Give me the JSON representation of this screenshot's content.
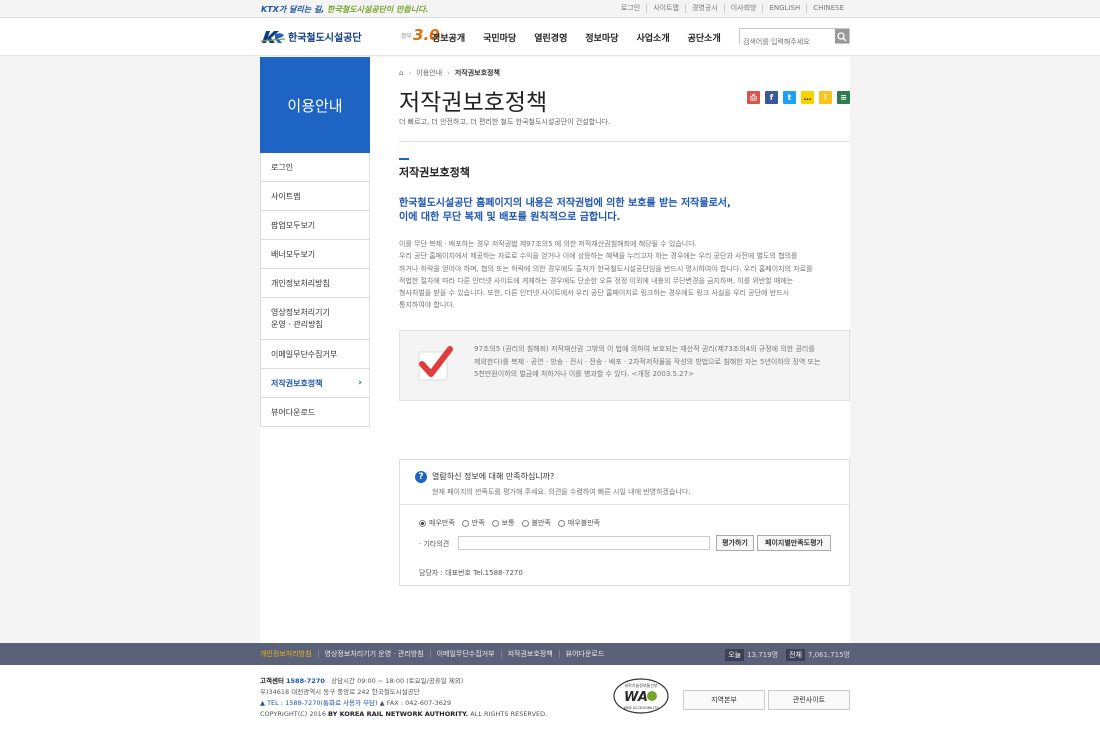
{
  "header": {
    "slogan_prefix": "KTX가 달리는 길, ",
    "slogan_highlight": "한국철도시설공단이 만듭니다.",
    "top_links": [
      "로그인",
      "사이트맵",
      "경영공시",
      "이사회방",
      "ENGLISH",
      "CHINESE"
    ],
    "logo_text": "한국철도시설공단",
    "gov30_small": "정부",
    "gov30_big": "3.0",
    "menu": [
      "정보공개",
      "국민마당",
      "열린경영",
      "정보마당",
      "사업소개",
      "공단소개"
    ],
    "search_placeholder": "검색어를 입력해주세요"
  },
  "sidebar": {
    "title": "이용안내",
    "items": [
      {
        "label": "로그인"
      },
      {
        "label": "사이트맵"
      },
      {
        "label": "팝업모두보기"
      },
      {
        "label": "배너모두보기"
      },
      {
        "label": "개인정보처리방침"
      },
      {
        "label": "영상정보처리기기\n운영 · 관리방침"
      },
      {
        "label": "이메일무단수집거부"
      },
      {
        "label": "저작권보호정책",
        "active": true
      },
      {
        "label": "뷰어다운로드"
      }
    ],
    "active_arrow": "›"
  },
  "breadcrumb": {
    "home": "⌂",
    "sep1": "›",
    "level1": "이용안내",
    "sep2": "›",
    "current": "저작권보호정책"
  },
  "page": {
    "title": "저작권보호정책",
    "description": "더 빠르고, 더 안전하고, 더 편리한 철도 한국철도시설공단이 건설합니다.",
    "section_title": "저작권보호정책",
    "lead_line1": "한국철도시설공단 홈페이지의 내용은 저작권법에 의한 보호를 받는 저작물로서,",
    "lead_line2": "이에 대한 무단 복제 및 배포를 원칙적으로 금합니다.",
    "body": [
      "이를 무단 복제 · 배포하는 경우 저작권법 제97조의5 에 의한 저작재산권침해죄에 해당될 수 있습니다.",
      "우리 공단 홈페이지에서 제공하는 자료로 수익을 얻거나 이에 상응하는 혜택을 누리고자 하는 경우에는 우리 공단과 사전에 별도의 협의를",
      "하거나 허락을 얻어야 하며, 협의 또는 허락에 의한 경우에도 출처가 한국철도시설공단임을 반드시 명시하여야 합니다. 우리 홈페이지의 자료를",
      "적법한 절차에 따라 다른 인터넷 사이트에 게재하는 경우에도 단순한 오류 정정 이외에 내용의 무단변경을 금지하며, 이를 위반할 때에는",
      "형사처벌을 받을 수 있습니다. 또한, 다른 인터넷 사이트에서 우리 공단 홈페이지로 링크하는 경우에도 링크 사실을 우리 공단에 반드시",
      "통지하여야 합니다."
    ],
    "notice": [
      "97조의5 (권리의 침해죄) 저작재산권 그밖의 이 법에 의하여 보호되는 재산적 권리(제73조의4의 규정에 의한 권리를",
      "제외한다)를 복제 · 공연 · 방송 · 전시 · 전송 · 배포 · 2차적저작물을 작성의 방법으로 침해한 자는 5년이하의 징역 또는",
      "5천만원이하의 벌금에 처하거나 이를 병과할 수 있다. <개정 2003.5.27>"
    ]
  },
  "share": [
    {
      "name": "print-icon",
      "color": "#d9534f",
      "glyph": "⎙"
    },
    {
      "name": "facebook-icon",
      "color": "#3b5998",
      "glyph": "f"
    },
    {
      "name": "twitter-icon",
      "color": "#1da1f2",
      "glyph": "t"
    },
    {
      "name": "kakaotalk-icon",
      "color": "#f7d300",
      "glyph": "…"
    },
    {
      "name": "kakaostory-icon",
      "color": "#f9c51a",
      "glyph": "!"
    },
    {
      "name": "band-icon",
      "color": "#2e7d4f",
      "glyph": "≡"
    }
  ],
  "survey": {
    "icon": "?",
    "question": "열람하신 정보에 대해 만족하십니까?",
    "sub": "현재 페이지의 만족도를 평가해 주세요. 의견을 수렴하여 빠른 시일 내에 반영하겠습니다.",
    "options": [
      "매우만족",
      "만족",
      "보통",
      "불만족",
      "매우불만족"
    ],
    "selected_index": 0,
    "etc_label": "· 기타의견",
    "etc_value": "",
    "submit_label": "평가하기",
    "page_rating_label": "페이지별만족도평가",
    "contact": "담당자 : 대표번호 Tel.1588-7270"
  },
  "footer_nav": {
    "links": [
      "개인정보처리방침",
      "영상정보처리기기 운영 · 관리방침",
      "이메일무단수집거부",
      "저작권보호정책",
      "뷰어다운로드"
    ],
    "today_label": "오늘",
    "today_value": "13,719명",
    "total_label": "전체",
    "total_value": "7,061,715명"
  },
  "footer": {
    "cs_label": "고객센터",
    "cs_phone": "1588-7270",
    "hours": "상담시간 09:00 ~ 18:00 (토요일/공휴일 제외)",
    "address": "우)34618 대전광역시 동구 중앙로 242 한국철도시설공단",
    "tel": "▲ TEL : 1588-7270(통화료 사용자 부담)",
    "fax": "▲ FAX : 042-607-3629",
    "copyright_pre": "COPYRIGHT(C) 2016 ",
    "copyright_org": "BY KOREA RAIL NETWORK AUTHORITY.",
    "copyright_post": " ALL RIGHTS RESERVED.",
    "wa_mark": "WA",
    "wa_top": "과학기술정보통신부",
    "wa_bottom": "WEB ACCESSIBILITY",
    "btn_region": "지역본부",
    "btn_related": "관련사이트"
  }
}
